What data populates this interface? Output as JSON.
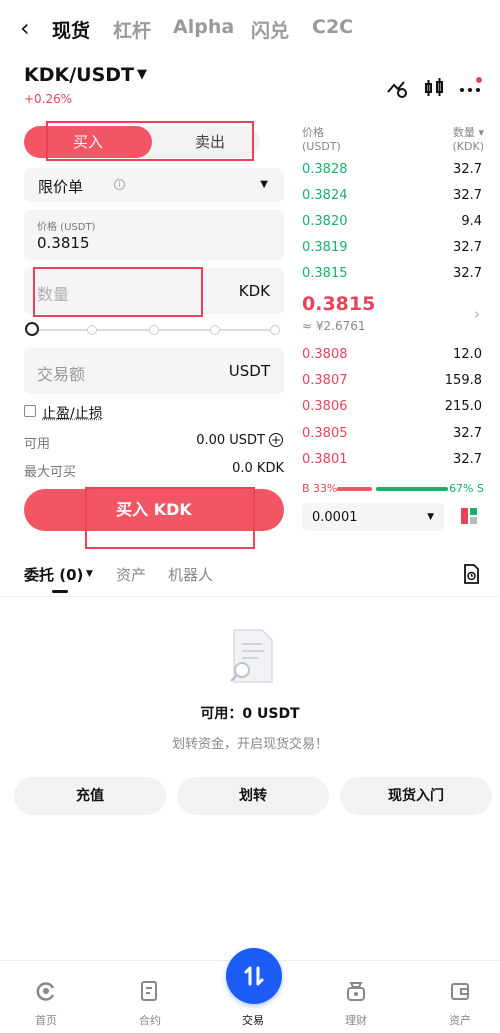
{
  "top_tabs": [
    "现货",
    "杠杆",
    "Alpha",
    "闪兑",
    "C2C"
  ],
  "pair": {
    "name": "KDK/USDT",
    "change": "+0.26%"
  },
  "side_toggle": {
    "buy": "买入",
    "sell": "卖出"
  },
  "order_form": {
    "order_type": "限价单",
    "price_label": "价格 (USDT)",
    "price_value": "0.3815",
    "quantity_placeholder": "数量",
    "quantity_unit": "KDK",
    "amount_placeholder": "交易额",
    "amount_unit": "USDT",
    "tpsl_label": "止盈/止损",
    "available_label": "可用",
    "available_value": "0.00 USDT",
    "max_buy_label": "最大可买",
    "max_buy_value": "0.0 KDK",
    "submit_label": "买入 KDK",
    "slider_percent": 0
  },
  "order_book": {
    "price_header": [
      "价格",
      "(USDT)"
    ],
    "qty_header": [
      "数量 ▾",
      "(KDK)"
    ],
    "asks": [
      {
        "price": "0.3828",
        "qty": "32.7"
      },
      {
        "price": "0.3824",
        "qty": "32.7"
      },
      {
        "price": "0.3820",
        "qty": "9.4"
      },
      {
        "price": "0.3819",
        "qty": "32.7"
      },
      {
        "price": "0.3815",
        "qty": "32.7"
      }
    ],
    "last_price": "0.3815",
    "last_price_fiat": "≈ ¥2.6761",
    "bids": [
      {
        "price": "0.3808",
        "qty": "12.0"
      },
      {
        "price": "0.3807",
        "qty": "159.8"
      },
      {
        "price": "0.3806",
        "qty": "215.0"
      },
      {
        "price": "0.3805",
        "qty": "32.7"
      },
      {
        "price": "0.3801",
        "qty": "32.7"
      }
    ],
    "buy_ratio": "B 33%",
    "sell_ratio": "67% S",
    "depth": "0.0001"
  },
  "orders_tabs": {
    "orders": "委托 (0)",
    "assets": "资产",
    "bots": "机器人"
  },
  "empty_state": {
    "available": "可用：0 USDT",
    "hint": "划转资金，开启现货交易！"
  },
  "actions": [
    "充值",
    "划转",
    "现货入门"
  ],
  "bottom_nav": [
    "首页",
    "合约",
    "交易",
    "理财",
    "资产"
  ],
  "colors": {
    "buy": "#f25564",
    "sell": "#18b06a",
    "accent": "#1a5cf5"
  }
}
